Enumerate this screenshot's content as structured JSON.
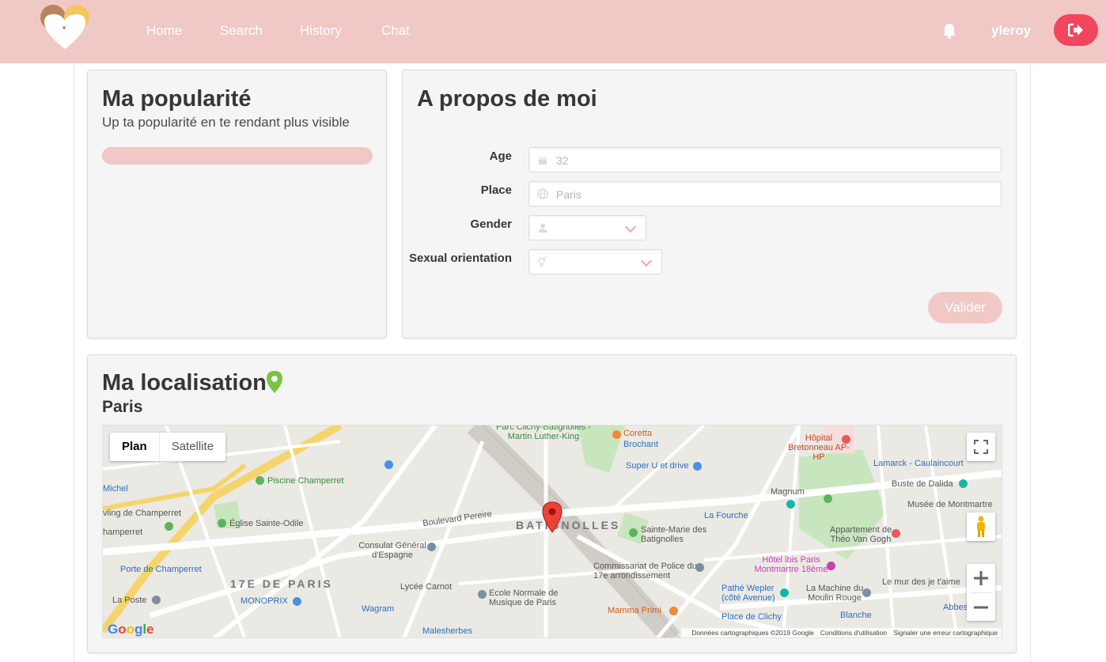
{
  "nav": {
    "links": [
      "Home",
      "Search",
      "History",
      "Chat"
    ],
    "username": "yleroy",
    "accent": "#f0c8c6",
    "logout_color": "#f1465e"
  },
  "popularity": {
    "title": "Ma popularité",
    "subtitle": "Up ta popularité en te rendant plus visible",
    "score": 0
  },
  "about": {
    "title": "A propos de moi",
    "fields": {
      "age_label": "Age",
      "age_placeholder": "32",
      "place_label": "Place",
      "place_placeholder": "Paris",
      "gender_label": "Gender",
      "gender_value": "",
      "orientation_label": "Sexual orientation",
      "orientation_value": ""
    },
    "submit_label": "Valider"
  },
  "location": {
    "title": "Ma localisation",
    "city": "Paris"
  },
  "map": {
    "type_plan": "Plan",
    "type_satellite": "Satellite",
    "google": "Google",
    "attribution": "Données cartographiques ©2019 Google",
    "terms": "Conditions d'utilisation",
    "report": "Signaler une erreur cartographique",
    "labels": {
      "batignolles": "BATIGNOLLES",
      "district": "17E DE PARIS",
      "piscine": "Piscine Champerret",
      "eglise": "Église Sainte-Odile",
      "consulat": "Consulat Général d'Espagne",
      "lycee": "Lycée Carnot",
      "ecole": "Ecole Normale de Musique de Paris",
      "wagram": "Wagram",
      "malesherbes": "Malesherbes",
      "la_poste": "La Poste",
      "monoprix": "MONOPRIX",
      "porte_champerret": "Porte de Champerret",
      "pereire": "Boulevard Pereire",
      "coretta": "Coretta",
      "brochant": "Brochant",
      "super_u": "Super U et drive",
      "sainte_marie": "Sainte-Marie des Batignolles",
      "commissariat": "Commissariat de Police du 17e arrondissement",
      "mamma": "Mamma Primi",
      "la_fourche": "La Fourche",
      "magnum": "Magnum",
      "hopital": "Hôpital Bretonneau AP-HP",
      "lamarck": "Lamarck - Caulaincourt",
      "buste": "Buste de Dalida",
      "musee": "Musée de Montmartre",
      "van_gogh": "Appartement de Théo Van Gogh",
      "ibis": "Hôtel ibis Paris Montmartre 18ème",
      "pathe": "Pathé Wepler (côté Avenue)",
      "moulin": "La Machine du Moulin Rouge",
      "place_clichy": "Place de Clichy",
      "blanche": "Blanche",
      "jetaime": "Le mur des je t'aime",
      "michel": "Michel",
      "bowling": "vling de Champerret",
      "champerret": "hamperret",
      "parc": "Parc Clichy-Batignolles - Martin Luther-King",
      "abbes": "Abbes"
    }
  }
}
